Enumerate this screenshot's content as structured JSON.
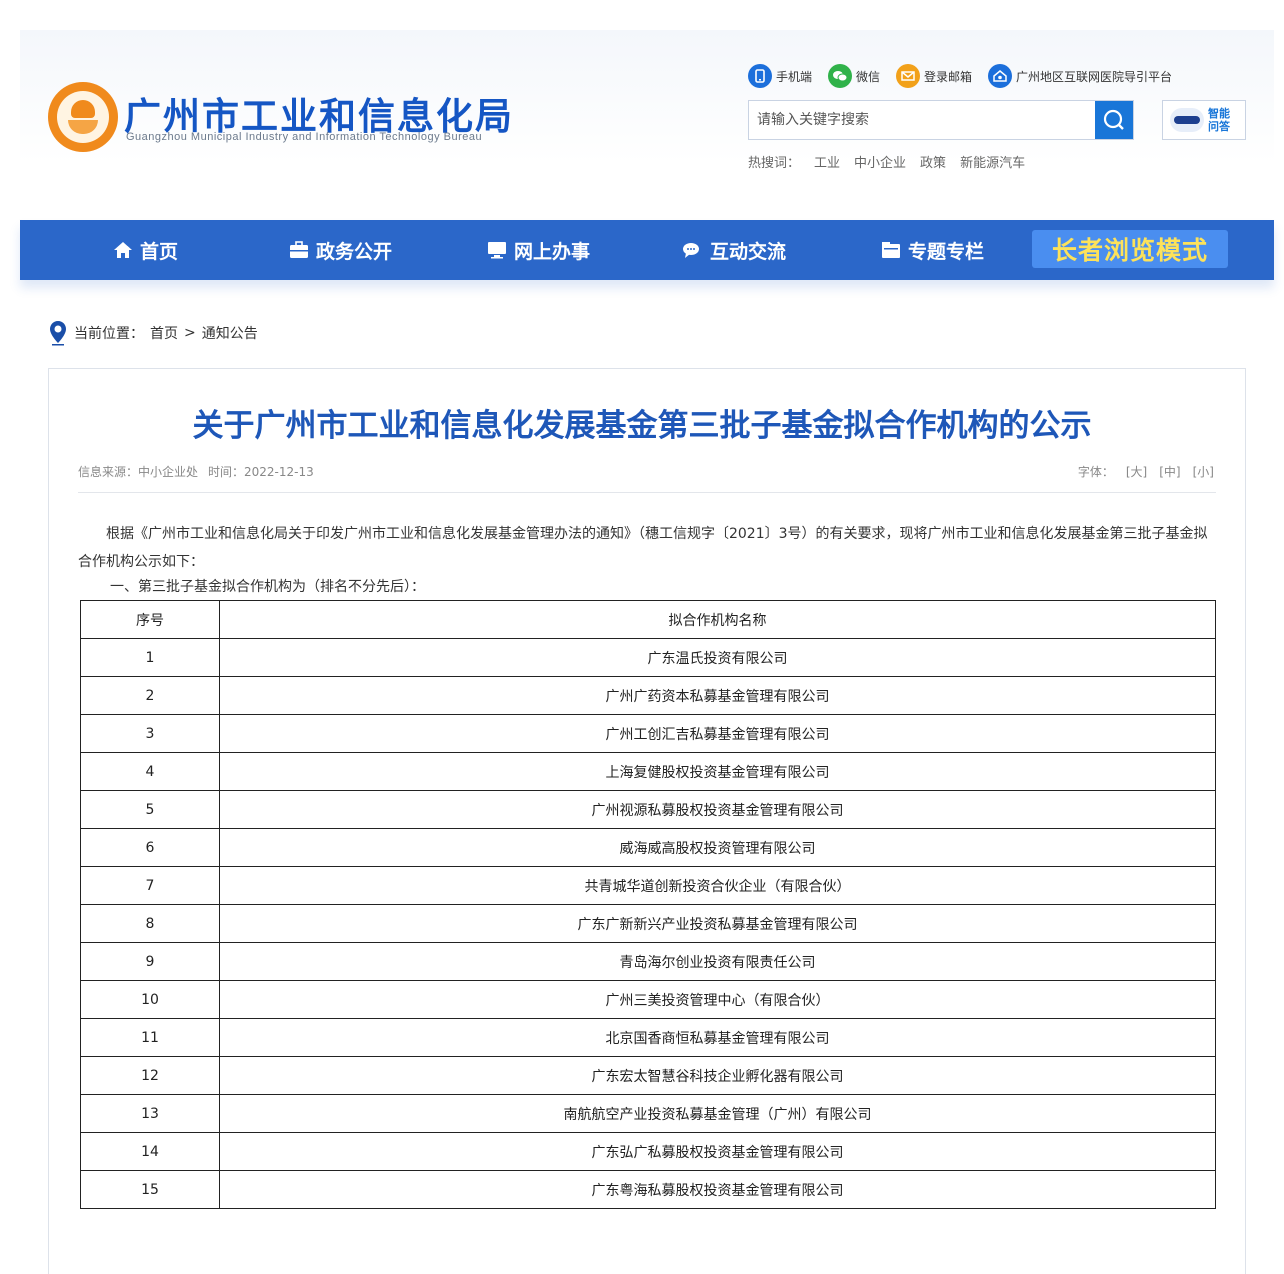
{
  "header": {
    "site_title": "广州市工业和信息化局",
    "site_subtitle": "Guangzhou Municipal Industry and Information Technology Bureau",
    "top_links": [
      {
        "label": "手机端",
        "icon": "mobile-icon"
      },
      {
        "label": "微信",
        "icon": "wechat-icon"
      },
      {
        "label": "登录邮箱",
        "icon": "mail-icon"
      },
      {
        "label": "广州地区互联网医院导引平台",
        "icon": "hospital-icon"
      }
    ],
    "search_placeholder": "请输入关键字搜索",
    "robot_label": "智能问答",
    "hot_label": "热搜词：",
    "hot_words": [
      "工业",
      "中小企业",
      "政策",
      "新能源汽车"
    ]
  },
  "nav": {
    "items": [
      {
        "label": "首页",
        "icon": "home-icon"
      },
      {
        "label": "政务公开",
        "icon": "briefcase-icon"
      },
      {
        "label": "网上办事",
        "icon": "monitor-icon"
      },
      {
        "label": "互动交流",
        "icon": "chat-icon"
      },
      {
        "label": "专题专栏",
        "icon": "folder-icon"
      }
    ],
    "elder_mode": "长者浏览模式"
  },
  "breadcrumb": {
    "label": "当前位置：",
    "home": "首页",
    "sep": ">",
    "current": "通知公告"
  },
  "article": {
    "title": "关于广州市工业和信息化发展基金第三批子基金拟合作机构的公示",
    "source": "信息来源：中小企业处",
    "time": "时间：2022-12-13",
    "font_label": "字体：",
    "font_large": "[大]",
    "font_medium": "[中]",
    "font_small": "[小]",
    "intro": "根据《广州市工业和信息化局关于印发广州市工业和信息化发展基金管理办法的通知》（穗工信规字〔2021〕3号）的有关要求，现将广州市工业和信息化发展基金第三批子基金拟合作机构公示如下：",
    "section1": "一、第三批子基金拟合作机构为（排名不分先后）：",
    "table": {
      "headers": [
        "序号",
        "拟合作机构名称"
      ],
      "rows": [
        [
          "1",
          "广东温氏投资有限公司"
        ],
        [
          "2",
          "广州广药资本私募基金管理有限公司"
        ],
        [
          "3",
          "广州工创汇吉私募基金管理有限公司"
        ],
        [
          "4",
          "上海复健股权投资基金管理有限公司"
        ],
        [
          "5",
          "广州视源私募股权投资基金管理有限公司"
        ],
        [
          "6",
          "威海威高股权投资管理有限公司"
        ],
        [
          "7",
          "共青城华道创新投资合伙企业（有限合伙）"
        ],
        [
          "8",
          "广东广新新兴产业投资私募基金管理有限公司"
        ],
        [
          "9",
          "青岛海尔创业投资有限责任公司"
        ],
        [
          "10",
          "广州三美投资管理中心（有限合伙）"
        ],
        [
          "11",
          "北京国香商恒私募基金管理有限公司"
        ],
        [
          "12",
          "广东宏太智慧谷科技企业孵化器有限公司"
        ],
        [
          "13",
          "南航航空产业投资私募基金管理（广州）有限公司"
        ],
        [
          "14",
          "广东弘广私募股权投资基金管理有限公司"
        ],
        [
          "15",
          "广东粤海私募股权投资基金管理有限公司"
        ]
      ]
    }
  },
  "colors": {
    "brand_blue": "#1556c4",
    "nav_bg": "#2b67c9",
    "elder_bg": "#4a8ef0",
    "elder_text": "#fde25a",
    "logo_orange": "#f08a1c"
  }
}
